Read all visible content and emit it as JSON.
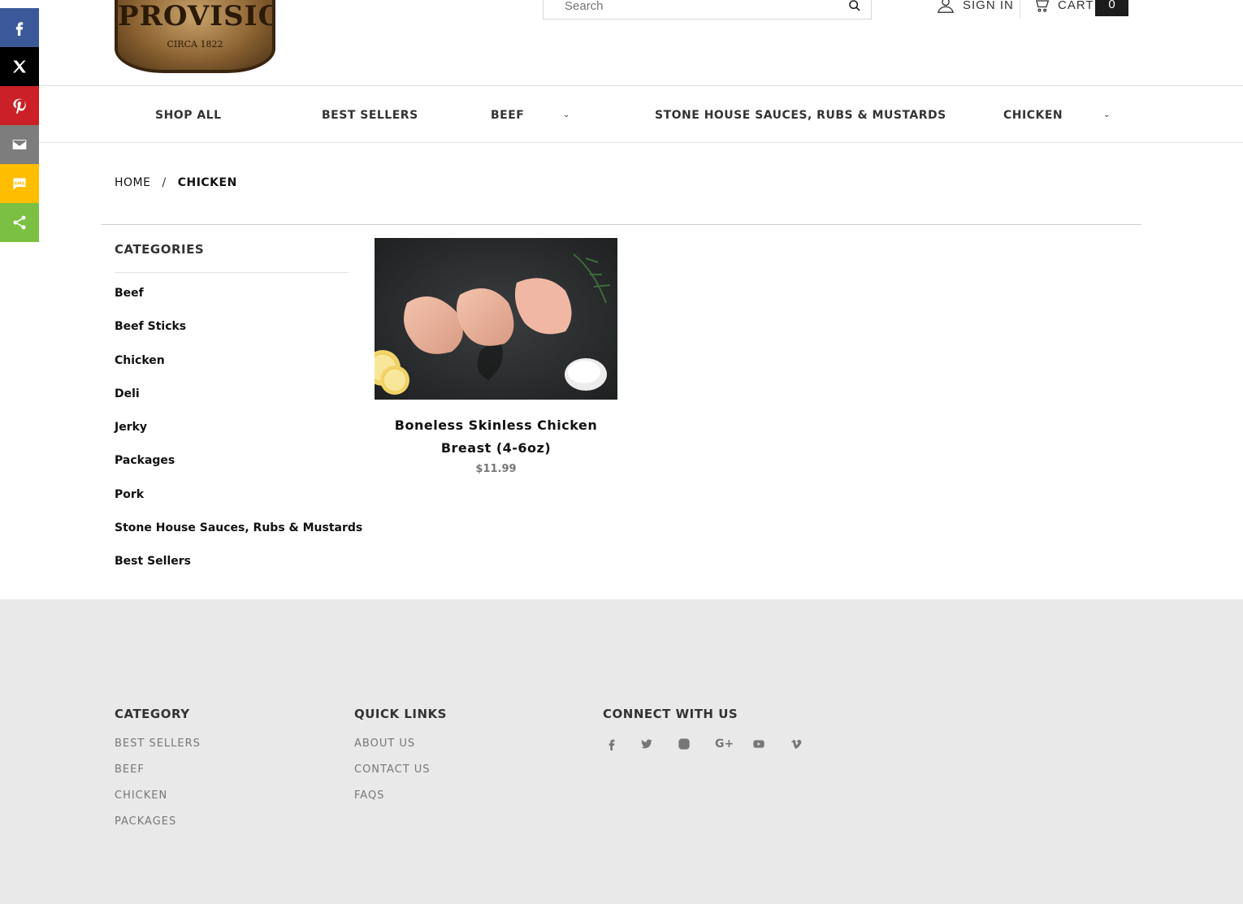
{
  "share_bar": {
    "items": [
      {
        "name": "facebook",
        "color": "#3b5998"
      },
      {
        "name": "x",
        "color": "#000000"
      },
      {
        "name": "pinterest",
        "color": "#cb2027"
      },
      {
        "name": "email",
        "color": "#7d7d7d"
      },
      {
        "name": "sms",
        "color": "#ffbd00"
      },
      {
        "name": "share",
        "color": "#7bc043"
      }
    ]
  },
  "header": {
    "logo_title": "PROVISIONS",
    "logo_sub": "CIRCA 1822",
    "search_placeholder": "Search",
    "sign_in": "SIGN IN",
    "cart_label": "CART",
    "cart_count": "0"
  },
  "nav": {
    "items": [
      "SHOP ALL",
      "BEST SELLERS",
      "BEEF",
      "STONE HOUSE SAUCES, RUBS & MUSTARDS",
      "CHICKEN"
    ]
  },
  "breadcrumb": {
    "home": "HOME",
    "separator": "/",
    "current": "CHICKEN"
  },
  "sidebar": {
    "heading": "CATEGORIES",
    "items": [
      "Beef",
      "Beef Sticks",
      "Chicken",
      "Deli",
      "Jerky",
      "Packages",
      "Pork",
      "Stone House Sauces, Rubs & Mustards",
      "Best Sellers"
    ]
  },
  "product": {
    "title": "Boneless Skinless Chicken Breast (4-6oz)",
    "price": "$11.99"
  },
  "footer": {
    "category": {
      "heading": "CATEGORY",
      "links": [
        "BEST SELLERS",
        "BEEF",
        "CHICKEN",
        "PACKAGES"
      ]
    },
    "quick_links": {
      "heading": "QUICK LINKS",
      "links": [
        "ABOUT US",
        "CONTACT US",
        "FAQS"
      ]
    },
    "connect": {
      "heading": "CONNECT WITH US",
      "icons": [
        "facebook-icon",
        "twitter-icon",
        "instagram-icon",
        "google-plus-icon",
        "youtube-icon",
        "vimeo-icon"
      ]
    }
  }
}
